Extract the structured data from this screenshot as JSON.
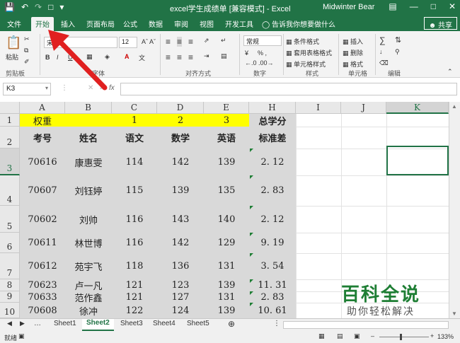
{
  "titlebar": {
    "save_icon": "save-icon",
    "undo_icon": "undo-icon",
    "redo_icon": "redo-icon",
    "new_icon": "new-doc-icon",
    "title": "excel学生成绩单 [兼容模式] - Excel",
    "user": "Midwinter Bear",
    "restore_icon": "ribbon-display-icon",
    "minimize_icon": "minimize-icon",
    "maximize_icon": "maximize-icon",
    "close_icon": "close-icon"
  },
  "tabs": [
    {
      "label": "文件"
    },
    {
      "label": "开始"
    },
    {
      "label": "插入"
    },
    {
      "label": "页面布局"
    },
    {
      "label": "公式"
    },
    {
      "label": "数据"
    },
    {
      "label": "审阅"
    },
    {
      "label": "视图"
    },
    {
      "label": "开发工具"
    },
    {
      "label": "告诉我你想要做什么"
    }
  ],
  "share_label": "共享",
  "ribbon": {
    "paste": "粘贴",
    "font_name": "宋",
    "font_size": "12",
    "bold": "B",
    "italic": "I",
    "number_format": "常规",
    "percent": "% ,",
    "currency": "¥",
    "cond_format": "条件格式",
    "table_format": "套用表格格式",
    "cell_style": "单元格样式",
    "insert": "插入",
    "delete": "删除",
    "format": "格式",
    "groups": {
      "clipboard": "剪贴板",
      "font": "字体",
      "alignment": "对齐方式",
      "number": "数字",
      "styles": "样式",
      "cells": "单元格",
      "editing": "编辑"
    }
  },
  "formula_bar": {
    "name_box": "K3",
    "fx": "fx",
    "value": ""
  },
  "columns": [
    "A",
    "B",
    "C",
    "D",
    "E",
    "H",
    "I",
    "J",
    "K"
  ],
  "rows": [
    "1",
    "2",
    "3",
    "4",
    "5",
    "6",
    "7",
    "8",
    "9",
    "10"
  ],
  "sheet": {
    "row1": {
      "label": "权重",
      "c": "1",
      "d": "2",
      "e": "3",
      "h": "总学分"
    },
    "row2": {
      "a": "考号",
      "b": "姓名",
      "c": "语文",
      "d": "数学",
      "e": "英语",
      "h": "标准差"
    },
    "data": [
      {
        "id": "70616",
        "name": "康惠雯",
        "c": "114",
        "d": "142",
        "e": "139",
        "h": "2. 12"
      },
      {
        "id": "70607",
        "name": "刘钰婷",
        "c": "115",
        "d": "139",
        "e": "135",
        "h": "2. 83"
      },
      {
        "id": "70602",
        "name": "刘帅",
        "c": "116",
        "d": "143",
        "e": "140",
        "h": "2. 12"
      },
      {
        "id": "70611",
        "name": "林世博",
        "c": "116",
        "d": "142",
        "e": "129",
        "h": "9. 19"
      },
      {
        "id": "70612",
        "name": "苑宇飞",
        "c": "118",
        "d": "136",
        "e": "131",
        "h": "3. 54"
      },
      {
        "id": "70623",
        "name": "卢一凡",
        "c": "121",
        "d": "123",
        "e": "139",
        "h": "11. 31"
      },
      {
        "id": "70633",
        "name": "范作鑫",
        "c": "121",
        "d": "127",
        "e": "131",
        "h": "2. 83"
      },
      {
        "id": "70608",
        "name": "徐冲",
        "c": "122",
        "d": "124",
        "e": "139",
        "h": "10. 61"
      }
    ]
  },
  "sheet_tabs": [
    "Sheet1",
    "Sheet2",
    "Sheet3",
    "Sheet4",
    "Sheet5"
  ],
  "active_sheet": "Sheet2",
  "status": {
    "left": "就绪",
    "zoom": "133%"
  },
  "watermark": {
    "line1": "百科全说",
    "line2": "助你轻松解决"
  },
  "colors": {
    "excel_green": "#217346",
    "yellow": "#ffff00",
    "gray_fill": "#d9d9d9",
    "arrow_red": "#e02020"
  }
}
